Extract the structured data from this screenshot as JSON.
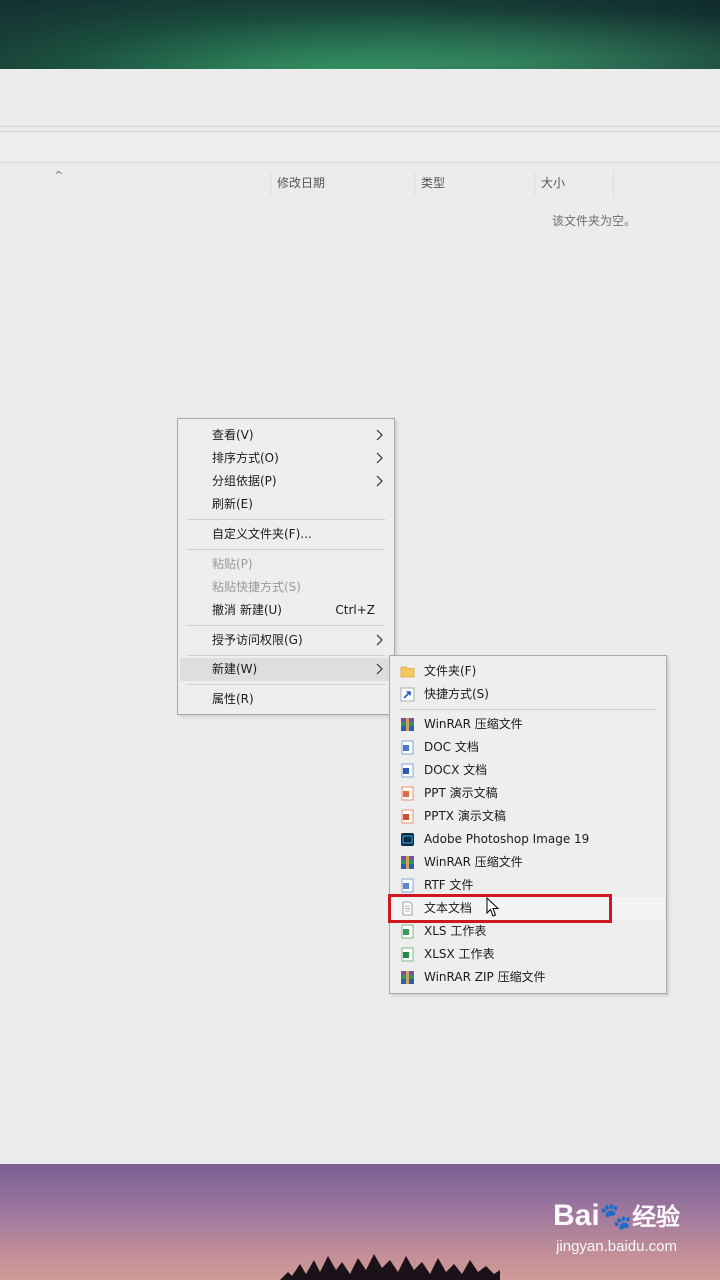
{
  "columns": {
    "sort_caret": "^",
    "date_modified": "修改日期",
    "type": "类型",
    "size": "大小"
  },
  "empty_message": "该文件夹为空。",
  "context_menu": {
    "view": "查看(V)",
    "sort_by": "排序方式(O)",
    "group_by": "分组依据(P)",
    "refresh": "刷新(E)",
    "customize_folder": "自定义文件夹(F)...",
    "paste": "粘贴(P)",
    "paste_shortcut": "粘贴快捷方式(S)",
    "undo_new": "撤消 新建(U)",
    "undo_shortcut": "Ctrl+Z",
    "give_access": "授予访问权限(G)",
    "new": "新建(W)",
    "properties": "属性(R)"
  },
  "new_submenu": [
    {
      "label": "文件夹(F)",
      "icon": "folder-icon"
    },
    {
      "label": "快捷方式(S)",
      "icon": "shortcut-icon"
    },
    {
      "label": "WinRAR 压缩文件",
      "icon": "winrar-icon"
    },
    {
      "label": "DOC 文档",
      "icon": "word-doc-icon"
    },
    {
      "label": "DOCX 文档",
      "icon": "word-docx-icon"
    },
    {
      "label": "PPT 演示文稿",
      "icon": "ppt-icon"
    },
    {
      "label": "PPTX 演示文稿",
      "icon": "pptx-icon"
    },
    {
      "label": "Adobe Photoshop Image 19",
      "icon": "photoshop-icon"
    },
    {
      "label": "WinRAR 压缩文件",
      "icon": "winrar-icon"
    },
    {
      "label": "RTF 文件",
      "icon": "rtf-icon"
    },
    {
      "label": "文本文档",
      "icon": "text-document-icon"
    },
    {
      "label": "XLS 工作表",
      "icon": "xls-icon"
    },
    {
      "label": "XLSX 工作表",
      "icon": "xlsx-icon"
    },
    {
      "label": "WinRAR ZIP 压缩文件",
      "icon": "winrar-zip-icon"
    }
  ],
  "watermark": {
    "logo_brand": "Bai",
    "logo_suffix": "经验",
    "url": "jingyan.baidu.com"
  },
  "colors": {
    "highlight_border": "#d0161f",
    "menu_background": "#eeeeee",
    "menu_hover": "#dedede"
  }
}
